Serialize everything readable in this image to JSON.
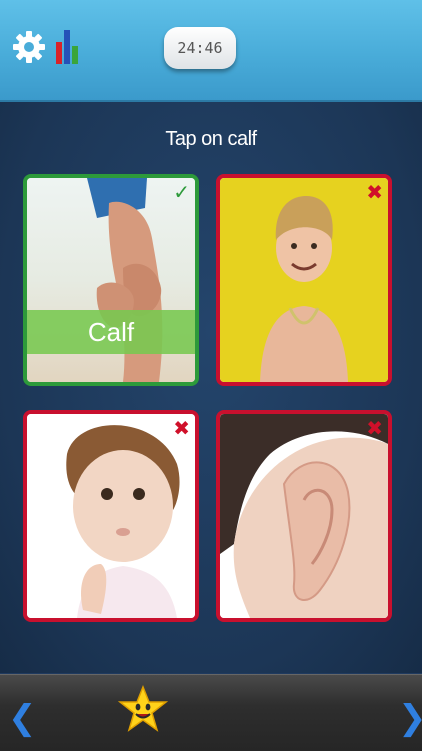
{
  "header": {
    "settings_icon": "gear-icon",
    "stats_icon": "bar-chart-icon",
    "timer": "24:46"
  },
  "quiz": {
    "prompt": "Tap on calf",
    "cards": [
      {
        "label": "Calf",
        "status": "correct",
        "image": "leg calf photo"
      },
      {
        "status": "wrong",
        "image": "smiling boy photo"
      },
      {
        "status": "wrong",
        "image": "toddler chin photo"
      },
      {
        "status": "wrong",
        "image": "ear photo"
      }
    ]
  },
  "footer": {
    "prev_icon": "chevron-left-icon",
    "star_icon": "star-face-icon",
    "next_icon": "chevron-right-icon"
  },
  "colors": {
    "correct": "#2d9a3a",
    "wrong": "#c8102e",
    "topbar": "#4aaedb",
    "arrow": "#2f7fe0"
  }
}
